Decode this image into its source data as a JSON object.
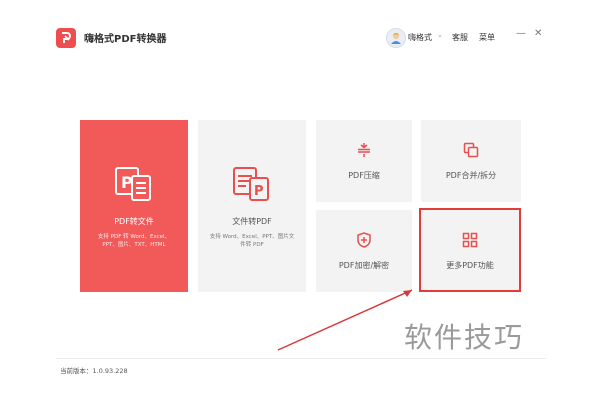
{
  "app": {
    "title": "嗨格式PDF转换器",
    "user_name": "嗨格式",
    "help_label": "客服",
    "menu_label": "菜单",
    "minimize_glyph": "—",
    "close_glyph": "✕",
    "user_dropdown_glyph": "⌄"
  },
  "tiles": {
    "pdf_to_file": {
      "label": "PDF转文件",
      "desc": "支持 PDF 转 Word、Excel、PPT、图片、TXT、HTML"
    },
    "file_to_pdf": {
      "label": "文件转PDF",
      "desc": "支持 Word、Excel、PPT、图片文件转 PDF"
    },
    "compress": {
      "label": "PDF压缩"
    },
    "merge_split": {
      "label": "PDF合并/拆分"
    },
    "encrypt": {
      "label": "PDF加密/解密"
    },
    "more": {
      "label": "更多PDF功能"
    }
  },
  "footer": {
    "version": "当前版本：1.0.93.228"
  },
  "watermark": "软件技巧",
  "colors": {
    "accent": "#f25a5a",
    "highlight_border": "#e23b3b",
    "tile_bg": "#f3f3f3",
    "icon_red": "#e8504f"
  },
  "icons": {
    "app_logo": "pdf-logo-icon",
    "avatar": "avatar-icon",
    "pdf_to_file": "document-convert-icon",
    "file_to_pdf": "document-to-pdf-icon",
    "compress": "compress-icon",
    "merge_split": "merge-icon",
    "encrypt": "shield-icon",
    "more": "grid-icon"
  }
}
